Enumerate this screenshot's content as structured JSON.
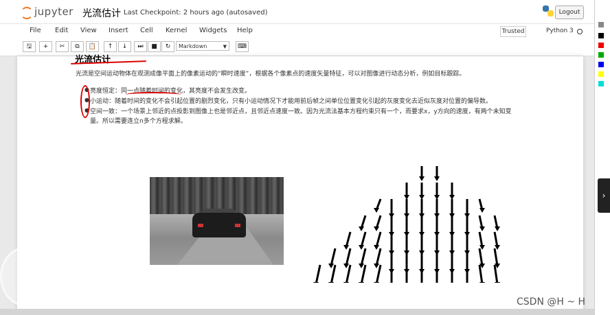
{
  "header": {
    "logo_text": "jupyter",
    "notebook_title": "光流估计",
    "checkpoint": "Last Checkpoint: 2 hours ago (autosaved)",
    "logout_label": "Logout"
  },
  "menubar": {
    "items": [
      "File",
      "Edit",
      "View",
      "Insert",
      "Cell",
      "Kernel",
      "Widgets",
      "Help"
    ],
    "trusted_label": "Trusted",
    "kernel_label": "Python 3"
  },
  "toolbar": {
    "buttons": [
      {
        "name": "save",
        "icon": "save-icon",
        "glyph": "🖫"
      },
      {
        "name": "insert-cell",
        "icon": "plus-icon",
        "glyph": "+"
      },
      {
        "name": "cut",
        "icon": "scissors-icon",
        "glyph": "✂"
      },
      {
        "name": "copy",
        "icon": "copy-icon",
        "glyph": "⧉"
      },
      {
        "name": "paste",
        "icon": "paste-icon",
        "glyph": "📋"
      },
      {
        "name": "move-up",
        "icon": "arrow-up-icon",
        "glyph": "↑"
      },
      {
        "name": "move-down",
        "icon": "arrow-down-icon",
        "glyph": "↓"
      },
      {
        "name": "run",
        "icon": "step-forward-icon",
        "glyph": "⏭"
      },
      {
        "name": "interrupt",
        "icon": "stop-icon",
        "glyph": "■"
      },
      {
        "name": "restart",
        "icon": "refresh-icon",
        "glyph": "↻"
      },
      {
        "name": "command-palette",
        "icon": "keyboard-icon",
        "glyph": "⌨"
      }
    ],
    "cell_type": "Markdown"
  },
  "content": {
    "heading": "光流估计",
    "intro": "光流是空间运动物体在观测成像平面上的像素运动的“瞬时速度”，根据各个像素点的速度矢量特征，可以对图像进行动态分析，例如目标跟踪。",
    "bullets": [
      "亮度恒定：同一点随着时间的变化，其亮度不会发生改变。",
      "小运动：随着时间的变化不会引起位置的剧烈变化，只有小运动情况下才能用前后帧之间单位位置变化引起的灰度变化去近似灰度对位置的偏导数。",
      "空间一致：一个场景上邻近的点投影到图像上也是邻近点，且邻近点速度一致。因为光流法基本方程约束只有一个，而要求x，y方向的速度，有两个未知变"
    ],
    "bullet3_cont": "量。所以需要连立n多个方程求解。"
  },
  "watermark": "CSDN @H ~ H",
  "colors": {
    "jupyter_orange": "#f37626",
    "annotation_red": "#dd0000"
  }
}
